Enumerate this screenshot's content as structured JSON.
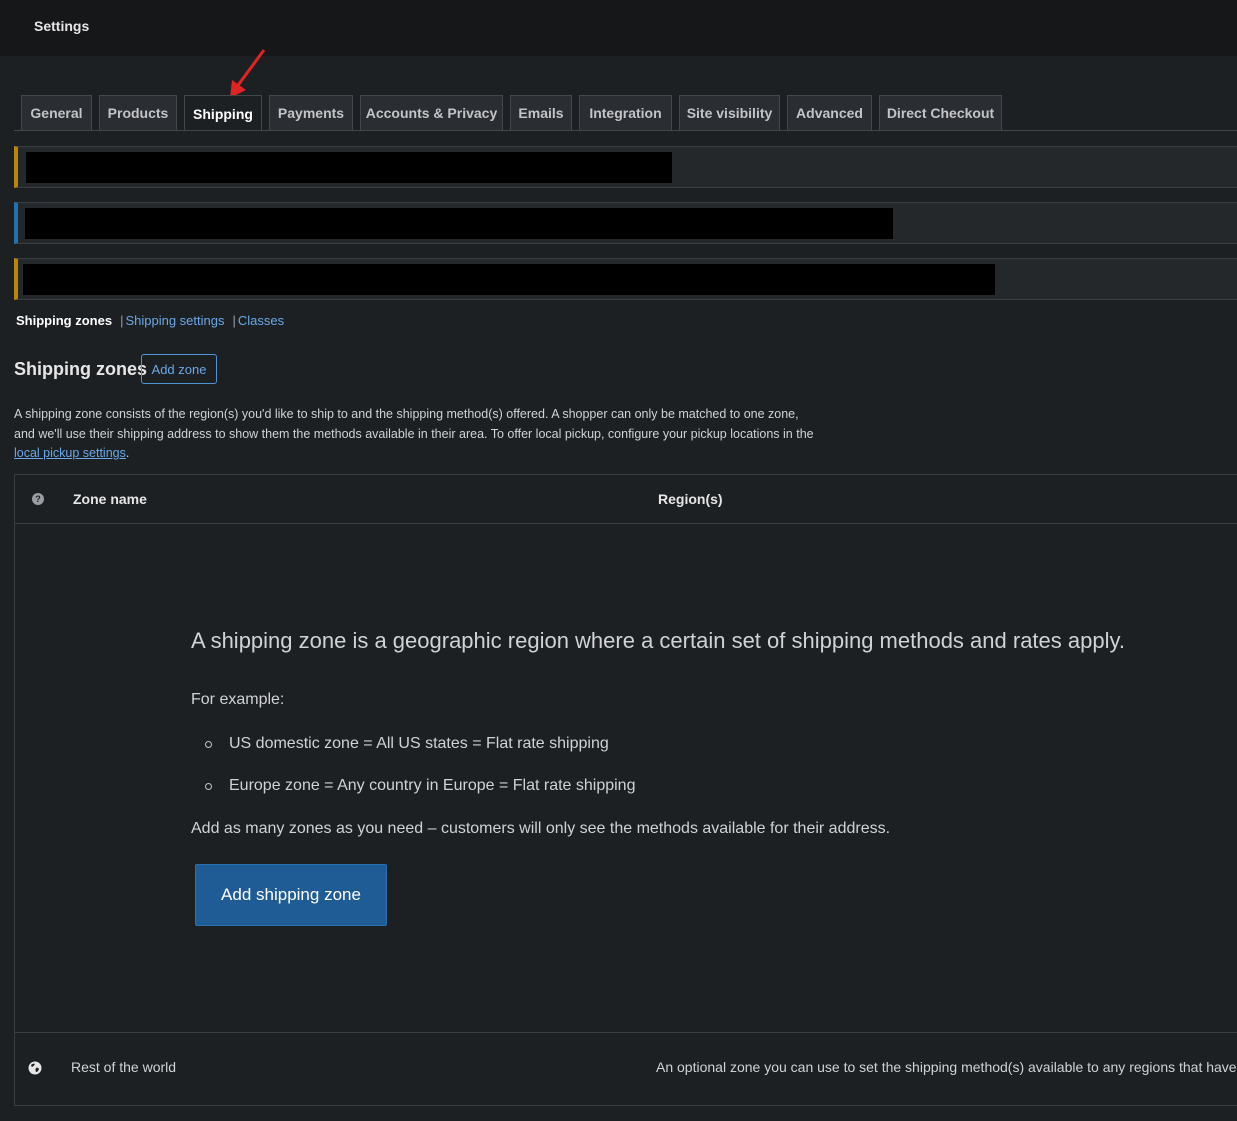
{
  "header": {
    "title": "Settings"
  },
  "tabs": [
    {
      "label": "General"
    },
    {
      "label": "Products"
    },
    {
      "label": "Shipping"
    },
    {
      "label": "Payments"
    },
    {
      "label": "Accounts & Privacy"
    },
    {
      "label": "Emails"
    },
    {
      "label": "Integration"
    },
    {
      "label": "Site visibility"
    },
    {
      "label": "Advanced"
    },
    {
      "label": "Direct Checkout"
    }
  ],
  "active_tab": "Shipping",
  "notices": [
    {
      "accent": "#b8860b"
    },
    {
      "accent": "#2271b1"
    },
    {
      "accent": "#b8860b"
    }
  ],
  "subnav": {
    "current": "Shipping zones",
    "sep": "|",
    "links": [
      "Shipping settings",
      "Classes"
    ]
  },
  "zones": {
    "heading": "Shipping zones",
    "add_zone": "Add zone",
    "desc_text": "A shipping zone consists of the region(s) you'd like to ship to and the shipping method(s) offered. A shopper can only be matched to one zone, and we'll use their shipping address to show them the methods available in their area. To offer local pickup, configure your pickup locations in the ",
    "desc_link": "local pickup settings",
    "desc_end": "."
  },
  "table": {
    "help": "?",
    "col_zone": "Zone name",
    "col_regions": "Region(s)"
  },
  "blank_state": {
    "lead": "A shipping zone is a geographic region where a certain set of shipping methods and rates apply.",
    "example": "For example:",
    "items": [
      "US domestic zone = All US states = Flat rate shipping",
      "Europe zone = Any country in Europe = Flat rate shipping"
    ],
    "outro": "Add as many zones as you need – customers will only see the methods available for their address.",
    "button": "Add shipping zone"
  },
  "rest_of_world": {
    "name": "Rest of the world",
    "desc": "An optional zone you can use to set the shipping method(s) available to any regions that have"
  },
  "colors": {
    "accent_blue": "#2271b1",
    "link": "#6aa7e8",
    "arrow": "#e02424"
  }
}
